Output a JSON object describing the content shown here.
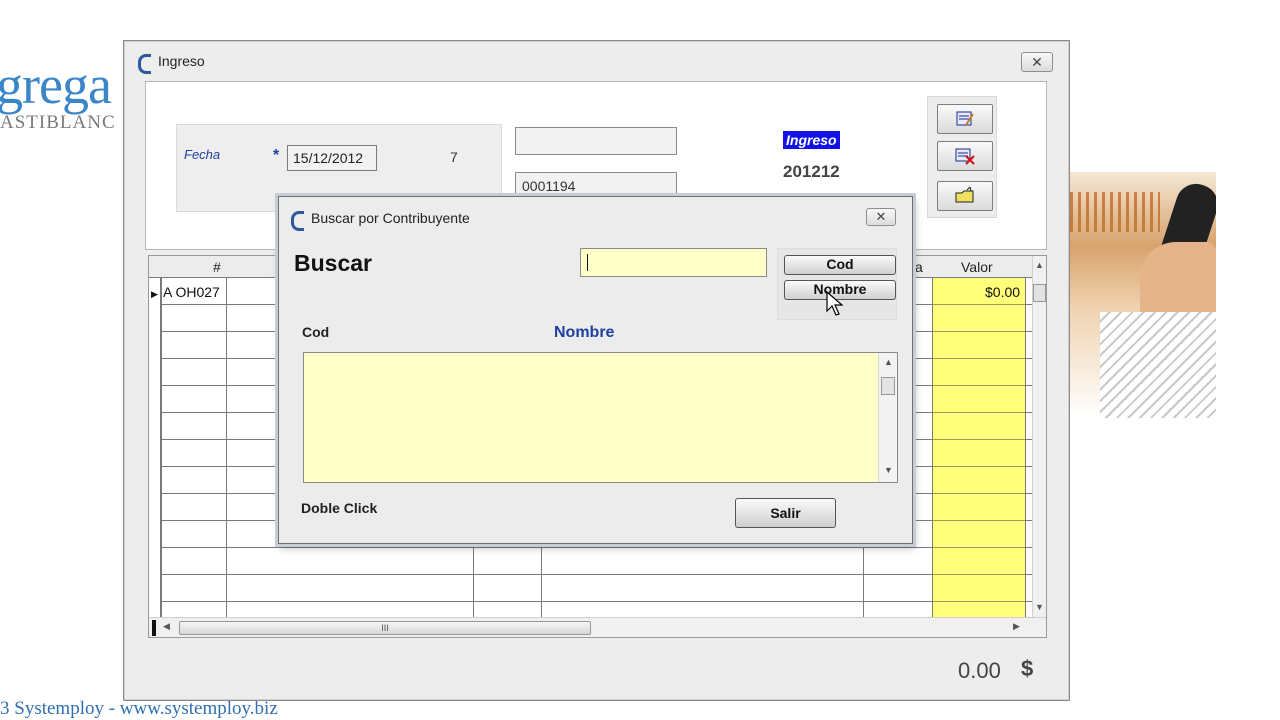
{
  "background": {
    "logo_text": "grega",
    "logo_sub": "ASTIBLANC",
    "footer": "3 Systemploy  - www.systemploy.biz"
  },
  "window": {
    "title": "Ingreso",
    "close_glyph": "✕",
    "header": {
      "fecha_label": "Fecha",
      "required_mark": "*",
      "fecha_value": "15/12/2012",
      "number": "7",
      "field_a_value": "",
      "field_b_value": "0001194",
      "badge": "Ingreso",
      "code": "201212"
    },
    "grid": {
      "columns": {
        "hash": "#",
        "a": "a",
        "valor": "Valor"
      },
      "rows": [
        {
          "id": "A OH027",
          "valor": "$0.00"
        }
      ],
      "hscroll_grip": "III"
    },
    "total": "0.00",
    "currency": "$"
  },
  "dialog": {
    "title": "Buscar por Contribuyente",
    "close_glyph": "✕",
    "heading": "Buscar",
    "search_value": "",
    "buttons": {
      "cod": "Cod",
      "nombre": "Nombre",
      "salir": "Salir"
    },
    "columns": {
      "cod": "Cod",
      "nombre": "Nombre"
    },
    "hint": "Doble Click"
  },
  "icons": [
    "app-icon",
    "edit-icon",
    "delete-icon",
    "folder-icon",
    "mouse-cursor-icon"
  ],
  "colors": {
    "yellow_cells": "#ffff7a",
    "list_bg": "#ffffc8",
    "accent_blue": "#1f3fa0",
    "badge_bg": "#1212e8"
  }
}
